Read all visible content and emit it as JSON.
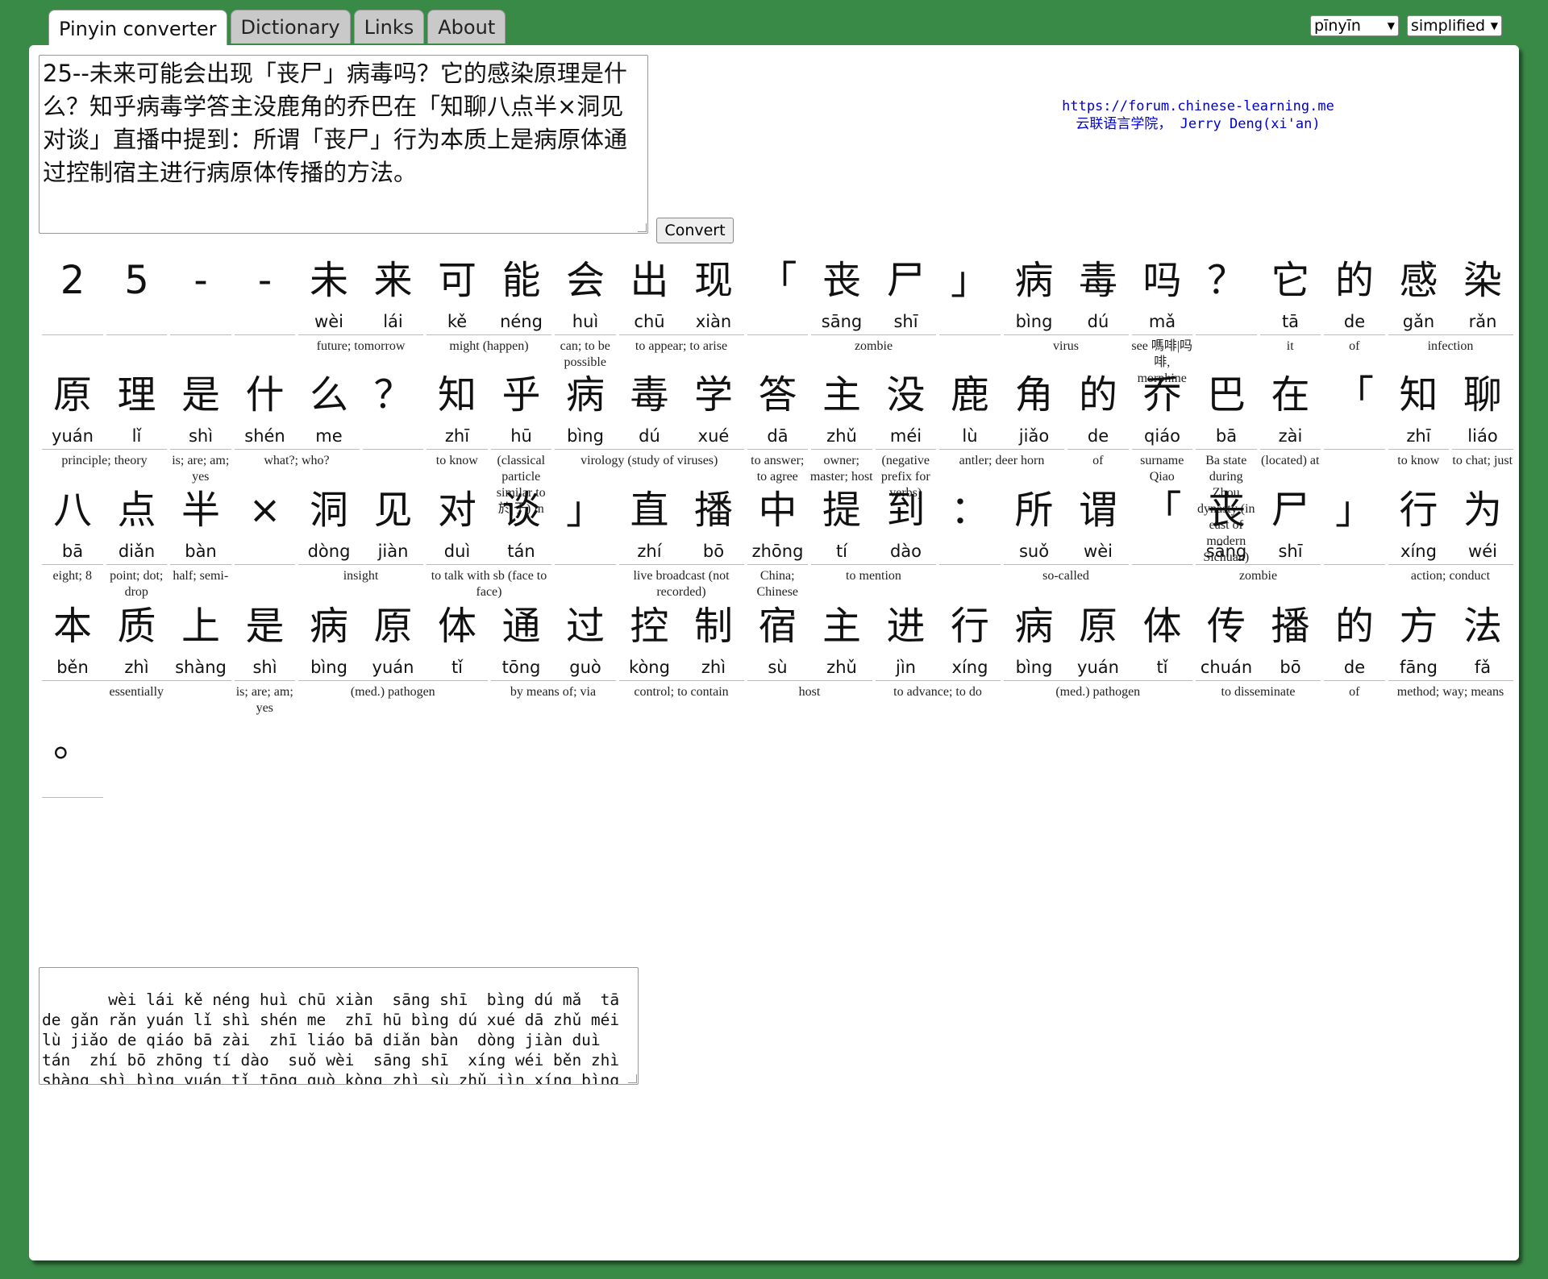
{
  "tabs": [
    {
      "label": "Pinyin converter",
      "active": true
    },
    {
      "label": "Dictionary",
      "active": false
    },
    {
      "label": "Links",
      "active": false
    },
    {
      "label": "About",
      "active": false
    }
  ],
  "selects": {
    "tone_style": "pīnyīn",
    "script": "simplified"
  },
  "input_text": "25--未来可能会出现「丧尸」病毒吗？它的感染原理是什么？知乎病毒学答主没鹿角的乔巴在「知聊八点半×洞见对谈」直播中提到：所谓「丧尸」行为本质上是病原体通过控制宿主进行病原体传播的方法。",
  "convert_label": "Convert",
  "links": {
    "url": "https://forum.chinese-learning.me",
    "credit": "云联语言学院， Jerry Deng(xi'an)"
  },
  "rows": [
    {
      "chars": [
        {
          "h": "2",
          "p": ""
        },
        {
          "h": "5",
          "p": ""
        },
        {
          "h": "-",
          "p": ""
        },
        {
          "h": "-",
          "p": ""
        },
        {
          "h": "未",
          "p": "wèi"
        },
        {
          "h": "来",
          "p": "lái"
        },
        {
          "h": "可",
          "p": "kě"
        },
        {
          "h": "能",
          "p": "néng"
        },
        {
          "h": "会",
          "p": "huì"
        },
        {
          "h": "出",
          "p": "chū"
        },
        {
          "h": "现",
          "p": "xiàn"
        },
        {
          "h": "「",
          "p": ""
        },
        {
          "h": "丧",
          "p": "sāng"
        },
        {
          "h": "尸",
          "p": "shī"
        },
        {
          "h": "」",
          "p": ""
        },
        {
          "h": "病",
          "p": "bìng"
        },
        {
          "h": "毒",
          "p": "dú"
        },
        {
          "h": "吗",
          "p": "mǎ"
        },
        {
          "h": "？",
          "p": ""
        },
        {
          "h": "它",
          "p": "tā"
        },
        {
          "h": "的",
          "p": "de"
        },
        {
          "h": "感",
          "p": "gǎn"
        },
        {
          "h": "染",
          "p": "rǎn"
        }
      ],
      "defs": [
        {
          "s": 4,
          "n": 2,
          "t": "future; tomorrow"
        },
        {
          "s": 6,
          "n": 2,
          "t": "might (happen)"
        },
        {
          "s": 8,
          "n": 1,
          "t": "can; to be possible"
        },
        {
          "s": 9,
          "n": 2,
          "t": "to appear; to arise"
        },
        {
          "s": 12,
          "n": 2,
          "t": "zombie"
        },
        {
          "s": 15,
          "n": 2,
          "t": "virus"
        },
        {
          "s": 17,
          "n": 1,
          "t": "see 嗎啡|吗啡, morphine"
        },
        {
          "s": 19,
          "n": 1,
          "t": "it"
        },
        {
          "s": 20,
          "n": 1,
          "t": "of"
        },
        {
          "s": 21,
          "n": 2,
          "t": "infection"
        }
      ],
      "groups": [
        [
          0,
          1
        ],
        [
          1,
          1
        ],
        [
          2,
          1
        ],
        [
          3,
          1
        ],
        [
          4,
          2
        ],
        [
          6,
          2
        ],
        [
          8,
          1
        ],
        [
          9,
          2
        ],
        [
          11,
          1
        ],
        [
          12,
          2
        ],
        [
          14,
          1
        ],
        [
          15,
          2
        ],
        [
          17,
          1
        ],
        [
          18,
          1
        ],
        [
          19,
          1
        ],
        [
          20,
          1
        ],
        [
          21,
          2
        ]
      ]
    },
    {
      "chars": [
        {
          "h": "原",
          "p": "yuán"
        },
        {
          "h": "理",
          "p": "lǐ"
        },
        {
          "h": "是",
          "p": "shì"
        },
        {
          "h": "什",
          "p": "shén"
        },
        {
          "h": "么",
          "p": "me"
        },
        {
          "h": "？",
          "p": ""
        },
        {
          "h": "知",
          "p": "zhī"
        },
        {
          "h": "乎",
          "p": "hū"
        },
        {
          "h": "病",
          "p": "bìng"
        },
        {
          "h": "毒",
          "p": "dú"
        },
        {
          "h": "学",
          "p": "xué"
        },
        {
          "h": "答",
          "p": "dā"
        },
        {
          "h": "主",
          "p": "zhǔ"
        },
        {
          "h": "没",
          "p": "méi"
        },
        {
          "h": "鹿",
          "p": "lù"
        },
        {
          "h": "角",
          "p": "jiǎo"
        },
        {
          "h": "的",
          "p": "de"
        },
        {
          "h": "乔",
          "p": "qiáo"
        },
        {
          "h": "巴",
          "p": "bā"
        },
        {
          "h": "在",
          "p": "zài"
        },
        {
          "h": "「",
          "p": ""
        },
        {
          "h": "知",
          "p": "zhī"
        },
        {
          "h": "聊",
          "p": "liáo"
        }
      ],
      "defs": [
        {
          "s": 0,
          "n": 2,
          "t": "principle; theory"
        },
        {
          "s": 2,
          "n": 1,
          "t": "is; are; am; yes"
        },
        {
          "s": 3,
          "n": 2,
          "t": "what?; who?"
        },
        {
          "s": 6,
          "n": 1,
          "t": "to know"
        },
        {
          "s": 7,
          "n": 1,
          "t": "(classical particle similar to 於|于) in"
        },
        {
          "s": 8,
          "n": 3,
          "t": "virology (study of viruses)"
        },
        {
          "s": 11,
          "n": 1,
          "t": "to answer; to agree"
        },
        {
          "s": 12,
          "n": 1,
          "t": "owner; master; host"
        },
        {
          "s": 13,
          "n": 1,
          "t": "(negative prefix for verbs)"
        },
        {
          "s": 14,
          "n": 2,
          "t": "antler; deer horn"
        },
        {
          "s": 16,
          "n": 1,
          "t": "of"
        },
        {
          "s": 17,
          "n": 1,
          "t": "surname Qiao"
        },
        {
          "s": 18,
          "n": 1,
          "t": "Ba state during Zhou dynasty (in east of modern Sichuan)"
        },
        {
          "s": 19,
          "n": 1,
          "t": "(located) at"
        },
        {
          "s": 21,
          "n": 1,
          "t": "to know"
        },
        {
          "s": 22,
          "n": 1,
          "t": "to chat; just"
        }
      ],
      "groups": [
        [
          0,
          2
        ],
        [
          2,
          1
        ],
        [
          3,
          2
        ],
        [
          5,
          1
        ],
        [
          6,
          1
        ],
        [
          7,
          1
        ],
        [
          8,
          3
        ],
        [
          11,
          1
        ],
        [
          12,
          1
        ],
        [
          13,
          1
        ],
        [
          14,
          2
        ],
        [
          16,
          1
        ],
        [
          17,
          1
        ],
        [
          18,
          1
        ],
        [
          19,
          1
        ],
        [
          20,
          1
        ],
        [
          21,
          1
        ],
        [
          22,
          1
        ]
      ]
    },
    {
      "chars": [
        {
          "h": "八",
          "p": "bā"
        },
        {
          "h": "点",
          "p": "diǎn"
        },
        {
          "h": "半",
          "p": "bàn"
        },
        {
          "h": "×",
          "p": ""
        },
        {
          "h": "洞",
          "p": "dòng"
        },
        {
          "h": "见",
          "p": "jiàn"
        },
        {
          "h": "对",
          "p": "duì"
        },
        {
          "h": "谈",
          "p": "tán"
        },
        {
          "h": "」",
          "p": ""
        },
        {
          "h": "直",
          "p": "zhí"
        },
        {
          "h": "播",
          "p": "bō"
        },
        {
          "h": "中",
          "p": "zhōng"
        },
        {
          "h": "提",
          "p": "tí"
        },
        {
          "h": "到",
          "p": "dào"
        },
        {
          "h": "：",
          "p": ""
        },
        {
          "h": "所",
          "p": "suǒ"
        },
        {
          "h": "谓",
          "p": "wèi"
        },
        {
          "h": "「",
          "p": ""
        },
        {
          "h": "丧",
          "p": "sāng"
        },
        {
          "h": "尸",
          "p": "shī"
        },
        {
          "h": "」",
          "p": ""
        },
        {
          "h": "行",
          "p": "xíng"
        },
        {
          "h": "为",
          "p": "wéi"
        }
      ],
      "defs": [
        {
          "s": 0,
          "n": 1,
          "t": "eight; 8"
        },
        {
          "s": 1,
          "n": 1,
          "t": "point; dot; drop"
        },
        {
          "s": 2,
          "n": 1,
          "t": "half; semi-"
        },
        {
          "s": 4,
          "n": 2,
          "t": "insight"
        },
        {
          "s": 6,
          "n": 2,
          "t": "to talk with sb (face to face)"
        },
        {
          "s": 9,
          "n": 2,
          "t": "live broadcast (not recorded)"
        },
        {
          "s": 11,
          "n": 1,
          "t": "China; Chinese"
        },
        {
          "s": 12,
          "n": 2,
          "t": "to mention"
        },
        {
          "s": 15,
          "n": 2,
          "t": "so-called"
        },
        {
          "s": 18,
          "n": 2,
          "t": "zombie"
        },
        {
          "s": 21,
          "n": 2,
          "t": "action; conduct"
        }
      ],
      "groups": [
        [
          0,
          1
        ],
        [
          1,
          1
        ],
        [
          2,
          1
        ],
        [
          3,
          1
        ],
        [
          4,
          2
        ],
        [
          6,
          2
        ],
        [
          8,
          1
        ],
        [
          9,
          2
        ],
        [
          11,
          1
        ],
        [
          12,
          2
        ],
        [
          14,
          1
        ],
        [
          15,
          2
        ],
        [
          17,
          1
        ],
        [
          18,
          2
        ],
        [
          20,
          1
        ],
        [
          21,
          2
        ]
      ]
    },
    {
      "chars": [
        {
          "h": "本",
          "p": "běn"
        },
        {
          "h": "质",
          "p": "zhì"
        },
        {
          "h": "上",
          "p": "shàng"
        },
        {
          "h": "是",
          "p": "shì"
        },
        {
          "h": "病",
          "p": "bìng"
        },
        {
          "h": "原",
          "p": "yuán"
        },
        {
          "h": "体",
          "p": "tǐ"
        },
        {
          "h": "通",
          "p": "tōng"
        },
        {
          "h": "过",
          "p": "guò"
        },
        {
          "h": "控",
          "p": "kòng"
        },
        {
          "h": "制",
          "p": "zhì"
        },
        {
          "h": "宿",
          "p": "sù"
        },
        {
          "h": "主",
          "p": "zhǔ"
        },
        {
          "h": "进",
          "p": "jìn"
        },
        {
          "h": "行",
          "p": "xíng"
        },
        {
          "h": "病",
          "p": "bìng"
        },
        {
          "h": "原",
          "p": "yuán"
        },
        {
          "h": "体",
          "p": "tǐ"
        },
        {
          "h": "传",
          "p": "chuán"
        },
        {
          "h": "播",
          "p": "bō"
        },
        {
          "h": "的",
          "p": "de"
        },
        {
          "h": "方",
          "p": "fāng"
        },
        {
          "h": "法",
          "p": "fǎ"
        }
      ],
      "defs": [
        {
          "s": 0,
          "n": 3,
          "t": "essentially"
        },
        {
          "s": 3,
          "n": 1,
          "t": "is; are; am; yes"
        },
        {
          "s": 4,
          "n": 3,
          "t": "(med.) pathogen"
        },
        {
          "s": 7,
          "n": 2,
          "t": "by means of; via"
        },
        {
          "s": 9,
          "n": 2,
          "t": "control; to contain"
        },
        {
          "s": 11,
          "n": 2,
          "t": "host"
        },
        {
          "s": 13,
          "n": 2,
          "t": "to advance; to do"
        },
        {
          "s": 15,
          "n": 3,
          "t": "(med.) pathogen"
        },
        {
          "s": 18,
          "n": 2,
          "t": "to disseminate"
        },
        {
          "s": 20,
          "n": 1,
          "t": "of"
        },
        {
          "s": 21,
          "n": 2,
          "t": "method; way; means"
        }
      ],
      "groups": [
        [
          0,
          3
        ],
        [
          3,
          1
        ],
        [
          4,
          3
        ],
        [
          7,
          2
        ],
        [
          9,
          2
        ],
        [
          11,
          2
        ],
        [
          13,
          2
        ],
        [
          15,
          3
        ],
        [
          18,
          2
        ],
        [
          20,
          1
        ],
        [
          21,
          2
        ]
      ]
    },
    {
      "chars": [
        {
          "h": "。",
          "p": ""
        }
      ],
      "defs": [],
      "groups": [
        [
          0,
          1
        ]
      ]
    }
  ],
  "output_text": "   wèi lái kě néng huì chū xiàn  sāng shī  bìng dú mǎ  tā de gǎn rǎn yuán lǐ shì shén me  zhī hū bìng dú xué dā zhǔ méi lù jiǎo de qiáo bā zài  zhī liáo bā diǎn bàn  dòng jiàn duì tán  zhí bō zhōng tí dào  suǒ wèi  sāng shī  xíng wéi běn zhì shàng shì bìng yuán tǐ tōng guò kòng zhì sù zhǔ jìn xíng bìng yuán tǐ chuán bō de fāng fǎ"
}
